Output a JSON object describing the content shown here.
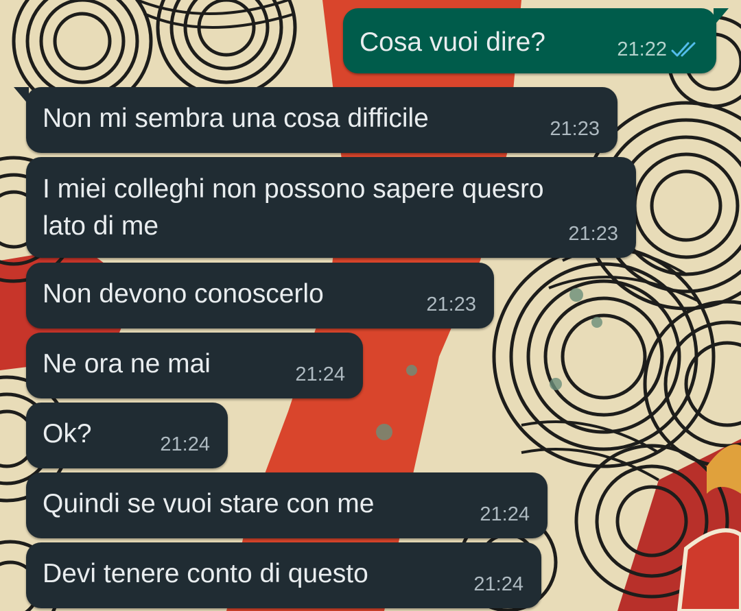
{
  "chat": {
    "messages": [
      {
        "direction": "outgoing",
        "text": "Cosa vuoi dire?",
        "time": "21:22",
        "status_icon": "double-check-read-icon"
      },
      {
        "direction": "incoming",
        "text": "Non mi sembra una cosa difficile",
        "time": "21:23"
      },
      {
        "direction": "incoming",
        "text": "I miei colleghi non possono sapere quesro\nlato di me",
        "time": "21:23"
      },
      {
        "direction": "incoming",
        "text": "Non devono conoscerlo",
        "time": "21:23"
      },
      {
        "direction": "incoming",
        "text": "Ne ora ne mai",
        "time": "21:24"
      },
      {
        "direction": "incoming",
        "text": "Ok?",
        "time": "21:24"
      },
      {
        "direction": "incoming",
        "text": "Quindi se vuoi stare con me",
        "time": "21:24"
      },
      {
        "direction": "incoming",
        "text": "Devi tenere conto di questo",
        "time": "21:24"
      }
    ]
  },
  "colors": {
    "incoming_bubble": "#202c33",
    "outgoing_bubble": "#005c4b",
    "read_ticks": "#53bdeb",
    "message_text": "#e9edef"
  }
}
